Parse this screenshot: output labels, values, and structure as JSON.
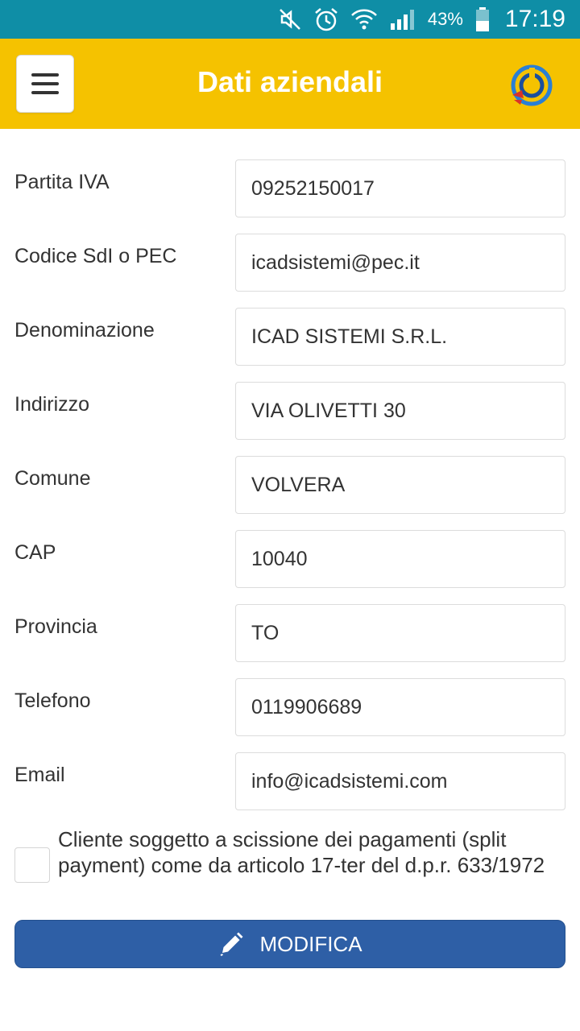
{
  "status_bar": {
    "battery_pct": "43%",
    "time": "17:19"
  },
  "header": {
    "title": "Dati aziendali"
  },
  "form": {
    "fields": [
      {
        "label": "Partita IVA",
        "value": "09252150017"
      },
      {
        "label": "Codice SdI o PEC",
        "value": "icadsistemi@pec.it"
      },
      {
        "label": "Denominazione",
        "value": "ICAD SISTEMI S.R.L."
      },
      {
        "label": "Indirizzo",
        "value": "VIA OLIVETTI 30"
      },
      {
        "label": "Comune",
        "value": "VOLVERA"
      },
      {
        "label": "CAP",
        "value": "10040"
      },
      {
        "label": "Provincia",
        "value": "TO"
      },
      {
        "label": "Telefono",
        "value": "0119906689"
      },
      {
        "label": "Email",
        "value": "info@icadsistemi.com"
      }
    ],
    "split_payment": {
      "label": "Cliente soggetto a scissione dei pagamenti (split payment) come da articolo 17-ter del d.p.r. 633/1972",
      "checked": false
    }
  },
  "actions": {
    "modifica_label": "MODIFICA"
  },
  "colors": {
    "status_bar": "#0f8ea6",
    "header": "#f5c200",
    "button": "#2e5fa6"
  }
}
